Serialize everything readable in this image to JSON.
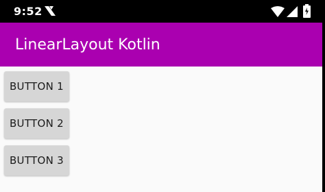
{
  "status_bar": {
    "time": "9:52"
  },
  "app_bar": {
    "title": "LinearLayout Kotlin"
  },
  "buttons": [
    {
      "label": "BUTTON 1"
    },
    {
      "label": "BUTTON 2"
    },
    {
      "label": "BUTTON 3"
    }
  ],
  "colors": {
    "app_bar": "#aa00b0",
    "status_bar": "#000000",
    "background": "#fafafa",
    "button": "#d6d6d6"
  },
  "icons": {
    "notification": "notification-icon",
    "wifi": "wifi-icon",
    "cell": "cell-signal-icon",
    "battery": "battery-charging-icon"
  }
}
